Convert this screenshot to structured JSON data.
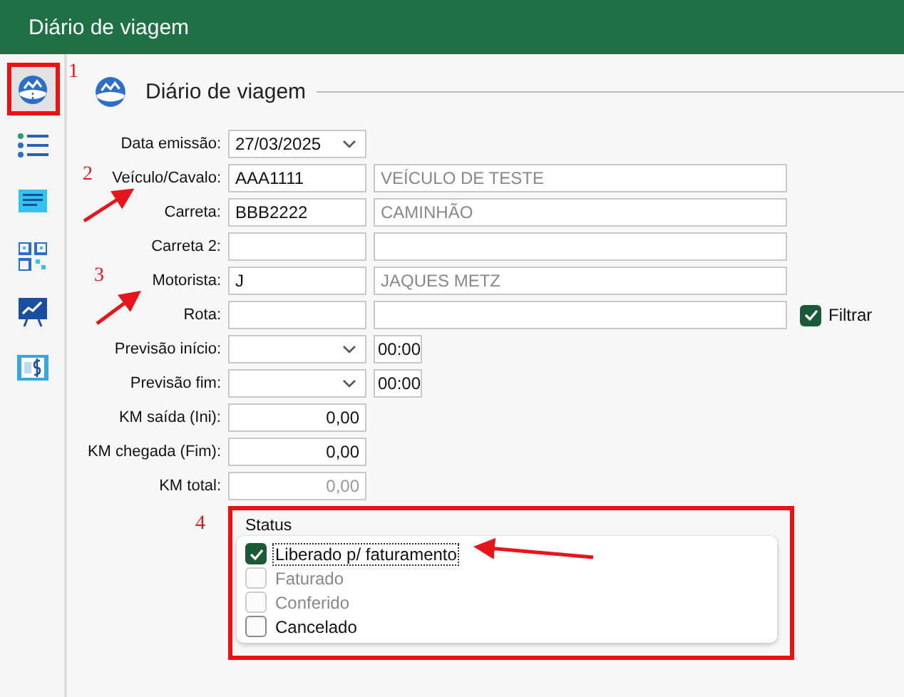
{
  "window": {
    "title": "Diário de viagem"
  },
  "sidebar": {
    "items": [
      {
        "selected": true
      },
      {
        "selected": false
      },
      {
        "selected": false
      },
      {
        "selected": false
      },
      {
        "selected": false
      },
      {
        "selected": false
      }
    ]
  },
  "header": {
    "title": "Diário de viagem"
  },
  "form": {
    "rows": [
      {
        "label": "Data emissão:",
        "kind": "date",
        "value": "27/03/2025"
      },
      {
        "label": "Veículo/Cavalo:",
        "kind": "lookup",
        "code": "AAA1111",
        "description": "VEÍCULO DE TESTE"
      },
      {
        "label": "Carreta:",
        "kind": "lookup",
        "code": "BBB2222",
        "description": "CAMINHÃO"
      },
      {
        "label": "Carreta 2:",
        "kind": "lookup"
      },
      {
        "label": "Motorista:",
        "kind": "lookup",
        "code": "J",
        "description": "JAQUES METZ"
      },
      {
        "label": "Rota:",
        "kind": "lookup",
        "filter": {
          "label": "Filtrar",
          "checked": true
        }
      },
      {
        "label": "Previsão início:",
        "kind": "datetime",
        "time": "00:00"
      },
      {
        "label": "Previsão fim:",
        "kind": "datetime",
        "time": "00:00"
      },
      {
        "label": "KM saída (Ini):",
        "kind": "number",
        "value": "0,00",
        "disabled": false
      },
      {
        "label": "KM chegada (Fim):",
        "kind": "number",
        "value": "0,00",
        "disabled": false
      },
      {
        "label": "KM total:",
        "kind": "number",
        "value": "0,00",
        "disabled": true
      }
    ]
  },
  "status": {
    "title": "Status",
    "options": [
      {
        "label": "Liberado p/ faturamento",
        "checked": true,
        "disabled": false,
        "focused": true
      },
      {
        "label": "Faturado",
        "checked": false,
        "disabled": true,
        "focused": false
      },
      {
        "label": "Conferido",
        "checked": false,
        "disabled": true,
        "focused": false
      },
      {
        "label": "Cancelado",
        "checked": false,
        "disabled": false,
        "focused": false
      }
    ]
  },
  "annotations": [
    {
      "number": "1"
    },
    {
      "number": "2"
    },
    {
      "number": "3"
    },
    {
      "number": "4"
    }
  ]
}
